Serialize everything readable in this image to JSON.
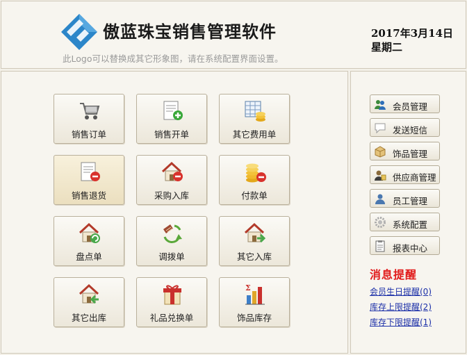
{
  "header": {
    "app_title": "傲蓝珠宝销售管理软件",
    "logo_note": "此Logo可以替换成其它形象图，请在系统配置界面设置。",
    "date": "2017年3月14日",
    "weekday": "星期二"
  },
  "tiles": [
    {
      "label": "销售订单",
      "icon": "shopping-cart-icon"
    },
    {
      "label": "销售开单",
      "icon": "invoice-add-icon"
    },
    {
      "label": "其它费用单",
      "icon": "ledger-coins-icon"
    },
    {
      "label": "销售退货",
      "icon": "return-document-icon"
    },
    {
      "label": "采购入库",
      "icon": "warehouse-in-icon"
    },
    {
      "label": "付款单",
      "icon": "coins-payment-icon"
    },
    {
      "label": "盘点单",
      "icon": "inventory-house-icon"
    },
    {
      "label": "调拨单",
      "icon": "transfer-arrows-icon"
    },
    {
      "label": "其它入库",
      "icon": "house-in-icon"
    },
    {
      "label": "其它出库",
      "icon": "house-out-icon"
    },
    {
      "label": "礼品兑换单",
      "icon": "gift-icon"
    },
    {
      "label": "饰品库存",
      "icon": "stock-chart-icon"
    }
  ],
  "sidebar": {
    "buttons": [
      {
        "label": "会员管理",
        "icon": "members-icon"
      },
      {
        "label": "发送短信",
        "icon": "message-icon"
      },
      {
        "label": "饰品管理",
        "icon": "box-icon"
      },
      {
        "label": "供应商管理",
        "icon": "supplier-icon"
      },
      {
        "label": "员工管理",
        "icon": "employee-icon"
      },
      {
        "label": "系统配置",
        "icon": "settings-gear-icon"
      },
      {
        "label": "报表中心",
        "icon": "report-icon"
      }
    ],
    "messages_title": "消息提醒",
    "messages": [
      "会员生日提醒(0)",
      "库存上限提醒(2)",
      "库存下限提醒(1)"
    ]
  },
  "colors": {
    "background": "#f3f0e8",
    "panel_border": "#cfc8b8",
    "logo_blue": "#2c86c9",
    "alert_red": "#e11a1a",
    "link_blue": "#1b2fa8"
  }
}
